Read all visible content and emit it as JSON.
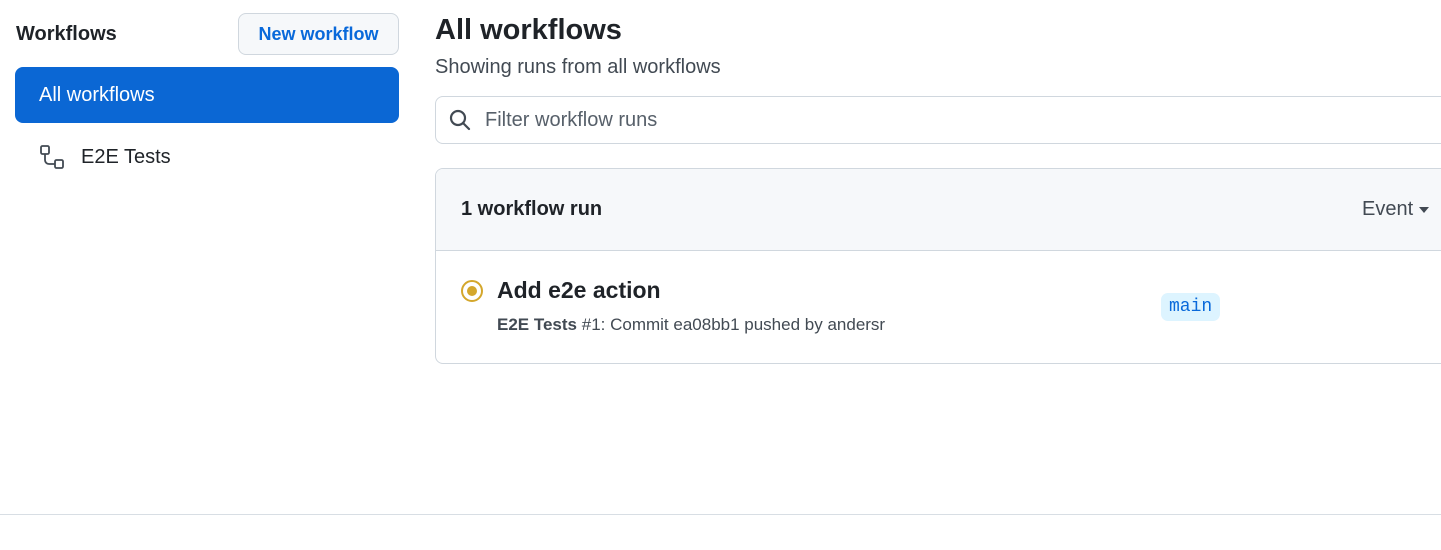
{
  "sidebar": {
    "title": "Workflows",
    "new_workflow_label": "New workflow",
    "items": [
      {
        "label": "All workflows",
        "selected": true
      },
      {
        "label": "E2E Tests",
        "icon": "workflow-icon"
      }
    ]
  },
  "main": {
    "title": "All workflows",
    "subtitle": "Showing runs from all workflows",
    "filter": {
      "placeholder": "Filter workflow runs",
      "value": "",
      "icon": "search-icon"
    },
    "runs": {
      "count_label": "1 workflow run",
      "event_filter_label": "Event",
      "items": [
        {
          "status": "in-progress",
          "status_color": "#d4a72c",
          "title": "Add e2e action",
          "workflow_name": "E2E Tests",
          "meta_rest": " #1: Commit ea08bb1 pushed by andersr",
          "branch": "main"
        }
      ]
    }
  },
  "colors": {
    "accent": "#0969da",
    "selected_bg": "#0b67d4",
    "in_progress": "#d4a72c"
  }
}
